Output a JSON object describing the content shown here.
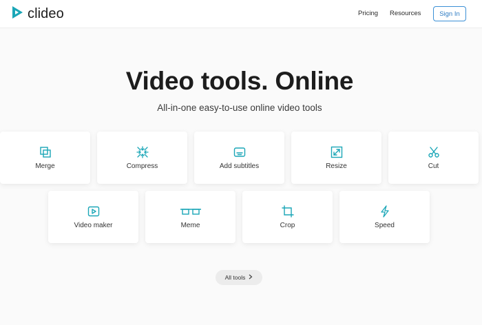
{
  "brand": {
    "name": "clideo",
    "logo_icon": "play-triangle-icon",
    "accent_color": "#1aa6b7"
  },
  "nav": {
    "pricing": "Pricing",
    "resources": "Resources",
    "sign_in": "Sign In"
  },
  "hero": {
    "title": "Video tools. Online",
    "subtitle": "All-in-one easy-to-use online video tools"
  },
  "tools": [
    {
      "label": "Merge",
      "icon": "merge-icon"
    },
    {
      "label": "Compress",
      "icon": "compress-icon"
    },
    {
      "label": "Add subtitles",
      "icon": "subtitles-icon"
    },
    {
      "label": "Resize",
      "icon": "resize-icon"
    },
    {
      "label": "Cut",
      "icon": "scissors-icon"
    },
    {
      "label": "Video maker",
      "icon": "video-play-icon"
    },
    {
      "label": "Meme",
      "icon": "glasses-icon"
    },
    {
      "label": "Crop",
      "icon": "crop-icon"
    },
    {
      "label": "Speed",
      "icon": "lightning-icon"
    }
  ],
  "all_tools": {
    "label": "All tools",
    "icon": "chevron-right-icon"
  }
}
